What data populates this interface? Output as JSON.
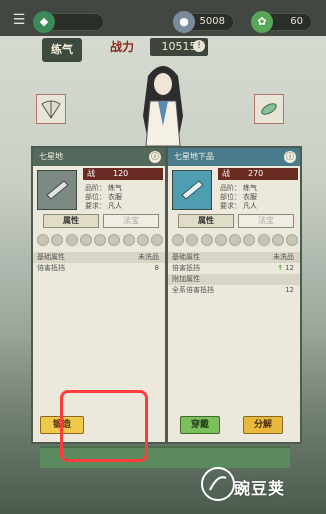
{
  "topbar": {
    "menu_icon": "☰",
    "resources": [
      {
        "icon": "jade-icon",
        "glyph": "◆",
        "value": ""
      },
      {
        "icon": "silver-icon",
        "glyph": "●",
        "value": "5008"
      },
      {
        "icon": "leaf-icon",
        "glyph": "✿",
        "value": "60"
      }
    ]
  },
  "header": {
    "nameplate": "练气",
    "power_label": "战力",
    "power_value": "10515",
    "power_info_icon": "!"
  },
  "left_panel": {
    "title": "七星地",
    "war_label": "战",
    "war_value": "120",
    "rank_label": "品阶：",
    "rank_value": "练气",
    "slot_label": "部位：",
    "slot_value": "衣服",
    "req_label": "要求：",
    "req_value": "凡人",
    "tab_active": "属性",
    "tab_inactive": "法宝",
    "rows": [
      {
        "label": "基础属性",
        "right": "未洗品"
      },
      {
        "label": "倍害抵挡",
        "right": "8"
      }
    ],
    "forge_button": "锻造"
  },
  "right_panel": {
    "title": "七星地下品",
    "war_label": "战",
    "war_value": "270",
    "rank_label": "品阶：",
    "rank_value": "练气",
    "slot_label": "部位：",
    "slot_value": "衣服",
    "req_label": "要求：",
    "req_value": "凡人",
    "tab_active": "属性",
    "tab_inactive": "法宝",
    "rows": [
      {
        "label": "基础属性",
        "right": "未洗品"
      },
      {
        "label": "倍害抵挡",
        "up": "↑",
        "right": "12"
      },
      {
        "label": "附加属性",
        "right": ""
      },
      {
        "label": "全系倍害抵挡",
        "right": "12"
      }
    ],
    "equip_button": "穿戴",
    "decompose_button": "分解"
  },
  "watermark": {
    "text": "豌豆荚"
  },
  "colors": {
    "highlight": "#ff3b3b",
    "forge": "#f0c94a",
    "equip": "#7cbf5d"
  }
}
